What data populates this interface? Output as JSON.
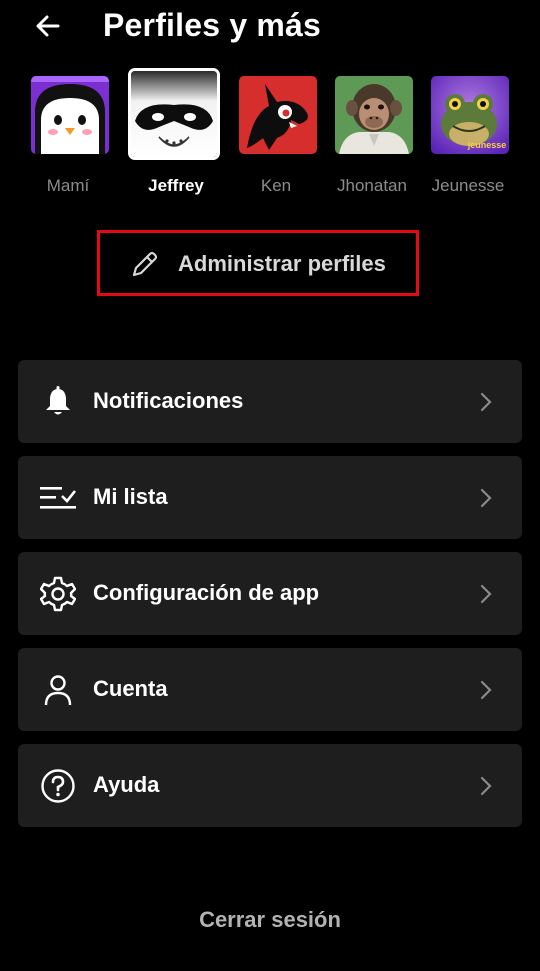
{
  "header": {
    "title": "Perfiles y más",
    "back_icon": "arrow-left-icon"
  },
  "profiles": [
    {
      "name": "Mamí",
      "avatar": "penguin-avatar",
      "color": "#7b2fd1"
    },
    {
      "name": "Jeffrey",
      "avatar": "raccoon-mask-avatar",
      "color": "#ffffff",
      "selected": true
    },
    {
      "name": "Ken",
      "avatar": "black-creature-avatar",
      "color": "#d62d2d"
    },
    {
      "name": "Jhonatan",
      "avatar": "chimp-avatar",
      "color": "#5e9a55"
    },
    {
      "name": "Jeunesse",
      "avatar": "frog-avatar",
      "color": "#7a3ccf",
      "badge": "jeunesse"
    }
  ],
  "manage": {
    "label": "Administrar perfiles",
    "highlight_color": "#e50914"
  },
  "menu": [
    {
      "label": "Notificaciones",
      "icon": "bell-icon"
    },
    {
      "label": "Mi lista",
      "icon": "list-check-icon"
    },
    {
      "label": "Configuración de app",
      "icon": "gear-icon"
    },
    {
      "label": "Cuenta",
      "icon": "person-icon"
    },
    {
      "label": "Ayuda",
      "icon": "help-circle-icon"
    }
  ],
  "logout": {
    "label": "Cerrar sesión"
  }
}
